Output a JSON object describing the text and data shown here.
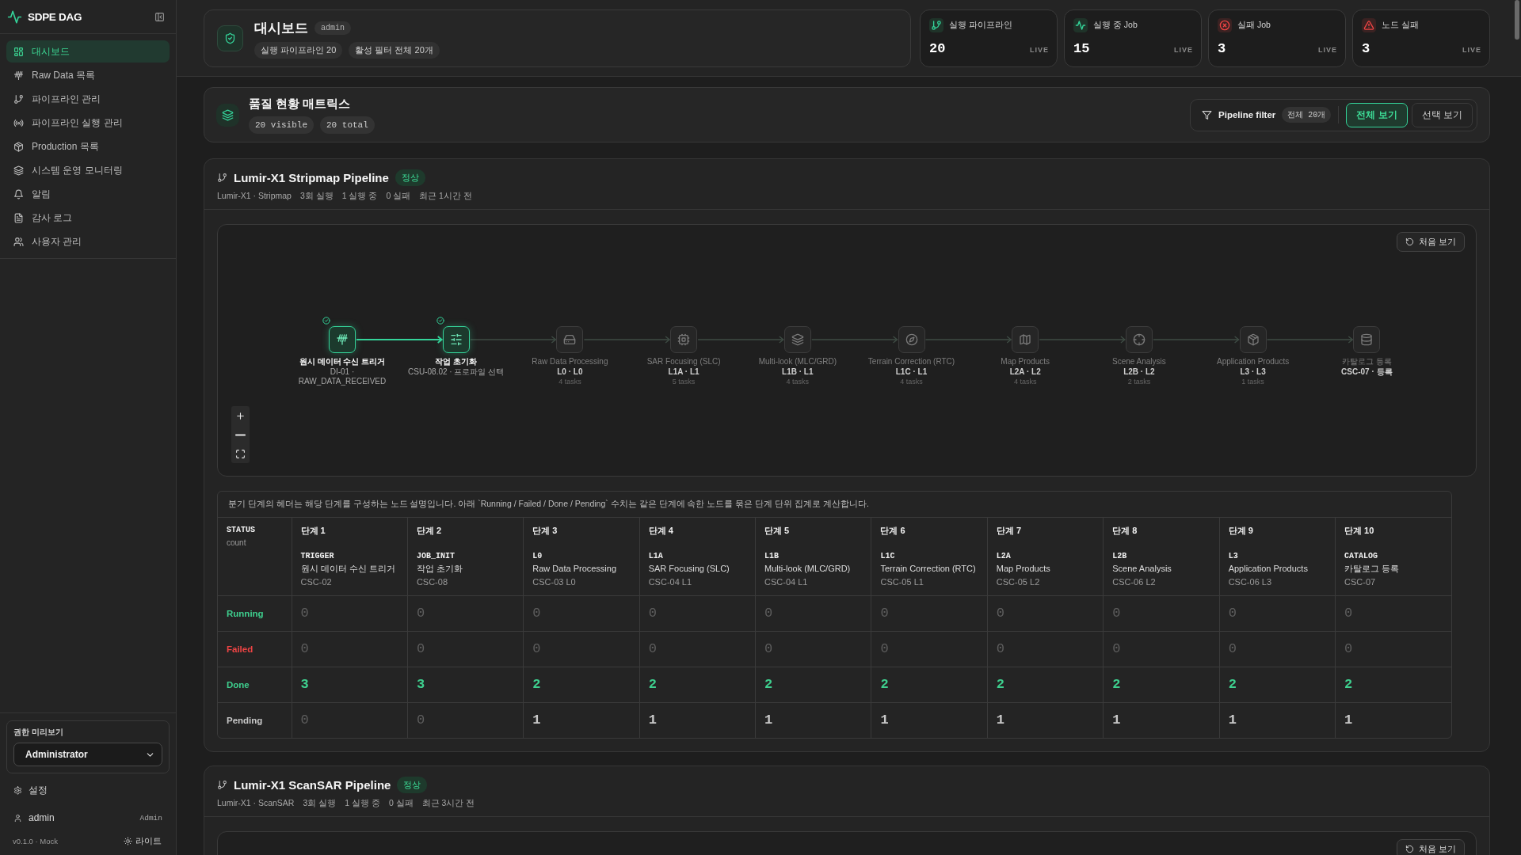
{
  "sidebar": {
    "brand": "SDPE DAG",
    "nav": [
      {
        "label": "대시보드",
        "selected": true
      },
      {
        "label": "Raw Data 목록",
        "selected": false
      },
      {
        "label": "파이프라인 관리",
        "selected": false
      },
      {
        "label": "파이프라인 실행 관리",
        "selected": false
      },
      {
        "label": "Production 목록",
        "selected": false
      },
      {
        "label": "시스템 운영 모니터링",
        "selected": false
      },
      {
        "label": "알림",
        "selected": false
      },
      {
        "label": "감사 로그",
        "selected": false
      },
      {
        "label": "사용자 관리",
        "selected": false
      }
    ],
    "role_preview": {
      "label": "권한 미리보기",
      "value": "Administrator"
    },
    "settings": "설정",
    "user": {
      "name": "admin",
      "role": "Admin"
    },
    "version": "v0.1.0 · Mock",
    "theme_toggle": "라이트"
  },
  "header": {
    "title": "대시보드",
    "badge": "admin",
    "chips": [
      "실행 파이프라인 20",
      "활성 필터 전체 20개"
    ]
  },
  "stats": [
    {
      "label": "실행 파이프라인",
      "value": "20",
      "tag": "LIVE",
      "kind": "success"
    },
    {
      "label": "실행 중 Job",
      "value": "15",
      "tag": "LIVE",
      "kind": "success"
    },
    {
      "label": "실패 Job",
      "value": "3",
      "tag": "LIVE",
      "kind": "failure"
    },
    {
      "label": "노드 실패",
      "value": "3",
      "tag": "LIVE",
      "kind": "failure"
    }
  ],
  "quality": {
    "title": "품질 현황 매트릭스",
    "chips": [
      "20 visible",
      "20 total"
    ],
    "filter": {
      "label": "Pipeline filter",
      "count": "전체 20개",
      "options": [
        {
          "label": "전체 보기",
          "selected": true
        },
        {
          "label": "선택 보기",
          "selected": false
        }
      ]
    }
  },
  "pipelines": [
    {
      "title": "Lumir-X1 Stripmap Pipeline",
      "status": "정상",
      "meta": [
        "Lumir-X1 · Stripmap",
        "3회 실행",
        "1 실행 중",
        "0 실패",
        "최근 1시간 전"
      ],
      "reset_button": "처음 보기",
      "dag": {
        "nodes": [
          {
            "title": "원시 데이터 수신 트리거",
            "detail": "DI-01 · RAW_DATA_RECEIVED",
            "done": true
          },
          {
            "title": "작업 초기화",
            "detail": "CSU-08.02 · 프로파일 선택",
            "done": true
          },
          {
            "title": "Raw Data Processing",
            "detail": "L0 · L0",
            "tasks": "4 tasks",
            "done": false
          },
          {
            "title": "SAR Focusing (SLC)",
            "detail": "L1A · L1",
            "tasks": "5 tasks",
            "done": false
          },
          {
            "title": "Multi-look (MLC/GRD)",
            "detail": "L1B · L1",
            "tasks": "4 tasks",
            "done": false
          },
          {
            "title": "Terrain Correction (RTC)",
            "detail": "L1C · L1",
            "tasks": "4 tasks",
            "done": false
          },
          {
            "title": "Map Products",
            "detail": "L2A · L2",
            "tasks": "4 tasks",
            "done": false
          },
          {
            "title": "Scene Analysis",
            "detail": "L2B · L2",
            "tasks": "2 tasks",
            "done": false
          },
          {
            "title": "Application Products",
            "detail": "L3 · L3",
            "tasks": "1 tasks",
            "done": false
          },
          {
            "title": "카탈로그 등록",
            "detail": "CSC-07 · 등록",
            "done": false
          }
        ]
      },
      "table": {
        "note": "분기 단계의 헤더는 해당 단계를 구성하는 노드 설명입니다. 아래 `Running / Failed / Done / Pending` 수치는 같은 단계에 속한 노드를 묶은 단계 단위 집계로 계산합니다.",
        "corner": {
          "title": "STATUS",
          "subtitle": "count"
        },
        "stages": [
          {
            "step": "단계 1",
            "code": "TRIGGER",
            "name": "원시 데이터 수신 트리거",
            "component": "CSC-02"
          },
          {
            "step": "단계 2",
            "code": "JOB_INIT",
            "name": "작업 초기화",
            "component": "CSC-08"
          },
          {
            "step": "단계 3",
            "code": "L0",
            "name": "Raw Data Processing",
            "component": "CSC-03 L0"
          },
          {
            "step": "단계 4",
            "code": "L1A",
            "name": "SAR Focusing (SLC)",
            "component": "CSC-04 L1"
          },
          {
            "step": "단계 5",
            "code": "L1B",
            "name": "Multi-look (MLC/GRD)",
            "component": "CSC-04 L1"
          },
          {
            "step": "단계 6",
            "code": "L1C",
            "name": "Terrain Correction (RTC)",
            "component": "CSC-05 L1"
          },
          {
            "step": "단계 7",
            "code": "L2A",
            "name": "Map Products",
            "component": "CSC-05 L2"
          },
          {
            "step": "단계 8",
            "code": "L2B",
            "name": "Scene Analysis",
            "component": "CSC-06 L2"
          },
          {
            "step": "단계 9",
            "code": "L3",
            "name": "Application Products",
            "component": "CSC-06 L3"
          },
          {
            "step": "단계 10",
            "code": "CATALOG",
            "name": "카탈로그 등록",
            "component": "CSC-07"
          }
        ],
        "rows": [
          {
            "label": "Running",
            "kind": "running",
            "values": [
              "0",
              "0",
              "0",
              "0",
              "0",
              "0",
              "0",
              "0",
              "0",
              "0"
            ]
          },
          {
            "label": "Failed",
            "kind": "failed",
            "values": [
              "0",
              "0",
              "0",
              "0",
              "0",
              "0",
              "0",
              "0",
              "0",
              "0"
            ]
          },
          {
            "label": "Done",
            "kind": "done",
            "values": [
              "3",
              "3",
              "2",
              "2",
              "2",
              "2",
              "2",
              "2",
              "2",
              "2"
            ]
          },
          {
            "label": "Pending",
            "kind": "pending",
            "values": [
              "0",
              "0",
              "1",
              "1",
              "1",
              "1",
              "1",
              "1",
              "1",
              "1"
            ]
          }
        ]
      }
    },
    {
      "title": "Lumir-X1 ScanSAR Pipeline",
      "status": "정상",
      "meta": [
        "Lumir-X1 · ScanSAR",
        "3회 실행",
        "1 실행 중",
        "0 실패",
        "최근 3시간 전"
      ],
      "reset_button": "처음 보기"
    }
  ]
}
